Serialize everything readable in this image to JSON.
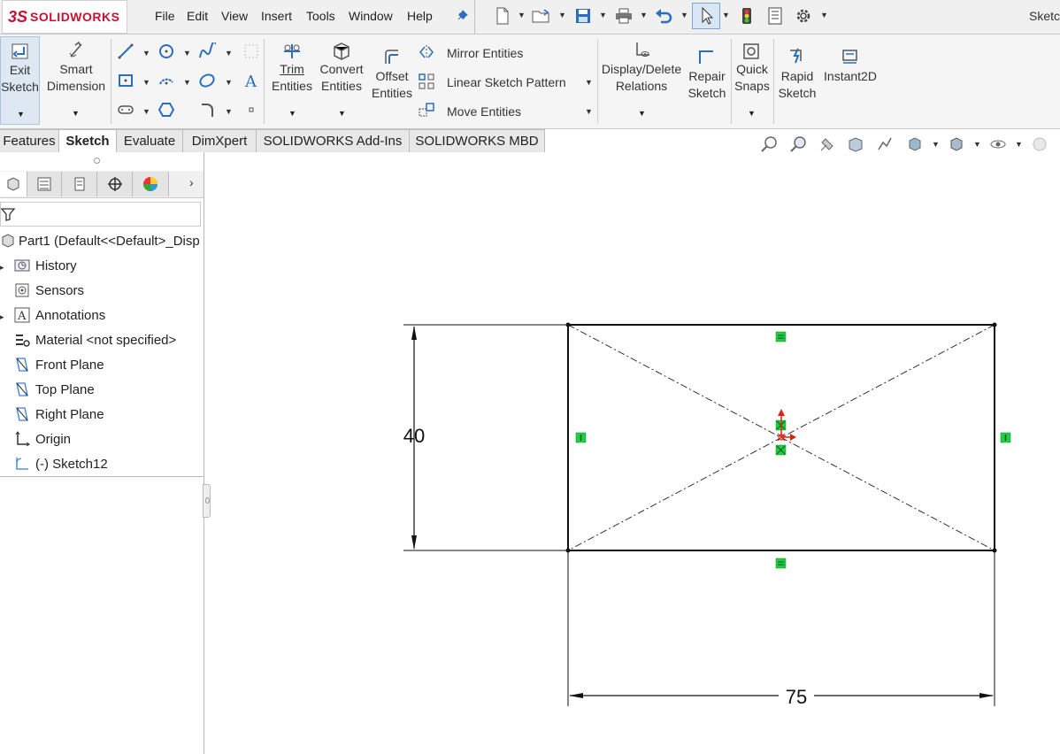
{
  "app": {
    "brand_prefix": "3S",
    "brand_name": "SOLIDWORKS",
    "title_right": "Sketc"
  },
  "menu": [
    "File",
    "Edit",
    "View",
    "Insert",
    "Tools",
    "Window",
    "Help"
  ],
  "ribbon": {
    "exit_sketch": [
      "Exit",
      "Sketch"
    ],
    "smart_dimension": [
      "Smart",
      "Dimension"
    ],
    "trim": [
      "Trim",
      "Entities"
    ],
    "convert": [
      "Convert",
      "Entities"
    ],
    "offset": [
      "Offset",
      "Entities"
    ],
    "mirror": "Mirror Entities",
    "linear_pattern": "Linear Sketch Pattern",
    "move": "Move Entities",
    "display_delete": [
      "Display/Delete",
      "Relations"
    ],
    "repair": [
      "Repair",
      "Sketch"
    ],
    "quick_snaps": [
      "Quick",
      "Snaps"
    ],
    "rapid_sketch": [
      "Rapid",
      "Sketch"
    ],
    "instant2d": "Instant2D"
  },
  "tabs": [
    {
      "label": "Features",
      "active": false
    },
    {
      "label": "Sketch",
      "active": true
    },
    {
      "label": "Evaluate",
      "active": false
    },
    {
      "label": "DimXpert",
      "active": false
    },
    {
      "label": "SOLIDWORKS Add-Ins",
      "active": false
    },
    {
      "label": "SOLIDWORKS MBD",
      "active": false
    }
  ],
  "tree": {
    "root": "Part1  (Default<<Default>_Disp",
    "items": [
      {
        "label": "History",
        "icon": "history-icon",
        "expandable": true
      },
      {
        "label": "Sensors",
        "icon": "sensors-icon",
        "expandable": false
      },
      {
        "label": "Annotations",
        "icon": "annotations-icon",
        "expandable": true
      },
      {
        "label": "Material <not specified>",
        "icon": "material-icon",
        "expandable": false
      },
      {
        "label": "Front Plane",
        "icon": "plane-icon",
        "expandable": false
      },
      {
        "label": "Top Plane",
        "icon": "plane-icon",
        "expandable": false
      },
      {
        "label": "Right Plane",
        "icon": "plane-icon",
        "expandable": false
      },
      {
        "label": "Origin",
        "icon": "origin-icon",
        "expandable": false
      },
      {
        "label": "(-) Sketch12",
        "icon": "sketch-icon",
        "expandable": false
      }
    ]
  },
  "sketch": {
    "height_dim": "40",
    "width_dim": "75",
    "relation_color": "#22cc44"
  },
  "colors": {
    "accent": "#c8102e",
    "line": "#111111"
  }
}
